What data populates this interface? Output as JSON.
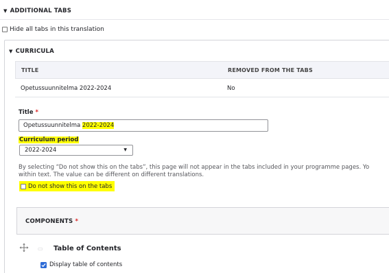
{
  "additional_tabs": {
    "label": "ADDITIONAL TABS"
  },
  "hide_all": {
    "label": "Hide all tabs in this translation"
  },
  "curricula": {
    "label": "CURRICULA",
    "table": {
      "headers": [
        "TITLE",
        "REMOVED FROM THE TABS"
      ],
      "rows": [
        {
          "title": "Opetussuunnitelma 2022-2024",
          "removed": "No"
        }
      ]
    },
    "title_field": {
      "label": "Title",
      "required_mark": "*",
      "value_prefix": "Opetussuunnitelma ",
      "value_highlight": "2022-2024"
    },
    "period_field": {
      "label": "Curriculum period",
      "selected": "2022-2024"
    },
    "help_line1": "By selecting “Do not show this on the tabs”, this page will not appear in the tabs included in your programme pages. Yo",
    "help_line2": "within text. The value can be different on different translations.",
    "do_not_show": {
      "label": "Do not show this on the tabs"
    },
    "components": {
      "label": "COMPONENTS",
      "required_mark": "*"
    },
    "component_item": {
      "title": "Table of Contents",
      "option_label": "Display table of contents",
      "option_checked": true
    }
  },
  "colors": {
    "highlight": "#ffff00",
    "required": "#dc2323",
    "checkbox_accent": "#2e6bd6"
  }
}
